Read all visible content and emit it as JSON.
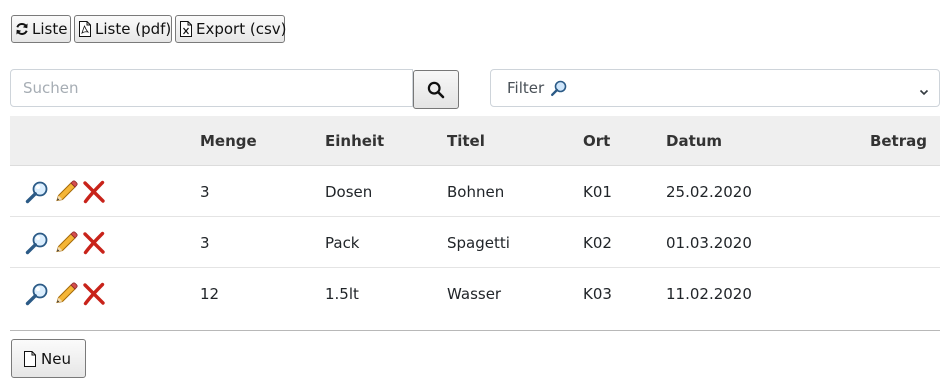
{
  "toolbar": {
    "list_label": "Liste",
    "pdf_label": "Liste (pdf)",
    "csv_label": "Export (csv)"
  },
  "search": {
    "placeholder": "Suchen"
  },
  "filter": {
    "selected": "Filter"
  },
  "table": {
    "headers": [
      "",
      "Menge",
      "Einheit",
      "Titel",
      "Ort",
      "Datum",
      "Betrag"
    ],
    "rows": [
      {
        "menge": "3",
        "einheit": "Dosen",
        "titel": "Bohnen",
        "ort": "K01",
        "datum": "25.02.2020",
        "betrag": ""
      },
      {
        "menge": "3",
        "einheit": "Pack",
        "titel": "Spagetti",
        "ort": "K02",
        "datum": "01.03.2020",
        "betrag": ""
      },
      {
        "menge": "12",
        "einheit": "1.5lt",
        "titel": "Wasser",
        "ort": "K03",
        "datum": "11.02.2020",
        "betrag": ""
      }
    ],
    "row_actions": [
      "magnifier-icon",
      "pencil-icon",
      "delete-x-icon"
    ]
  },
  "footer": {
    "new_label": "Neu"
  },
  "colors": {
    "header_bg": "#efefef",
    "delete_red": "#c8231a",
    "pencil_orange": "#f0a020"
  }
}
